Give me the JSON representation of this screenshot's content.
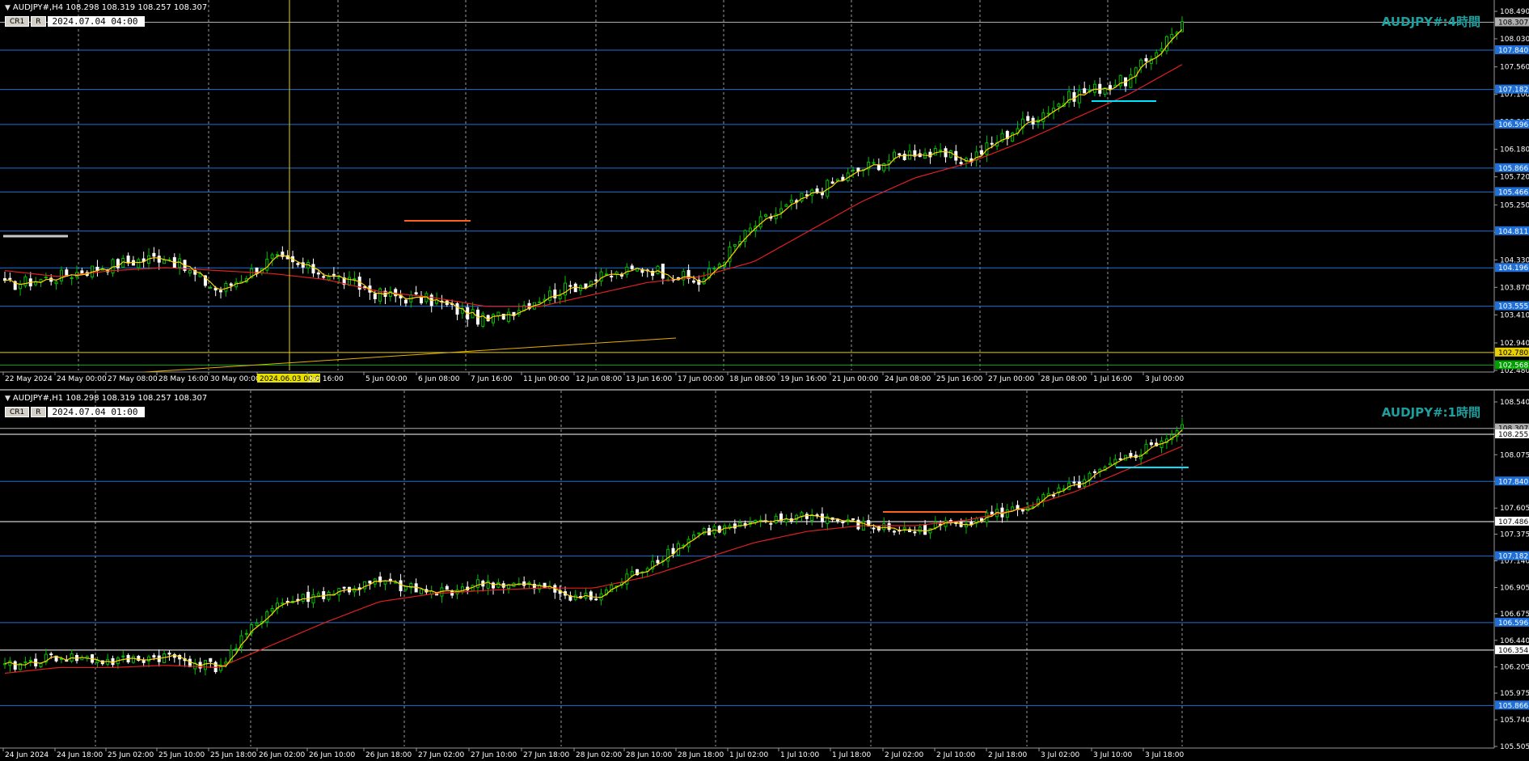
{
  "top": {
    "header": "AUDJPY#,H4  108.298 108.319 108.257 108.307",
    "ctrl_label": "CR1",
    "ctrl_r": "R",
    "timestamp": "2024.07.04 04:00",
    "title": "AUDJPY#:4時間",
    "price_ticks": [
      "108.490",
      "108.030",
      "107.560",
      "107.100",
      "106.640",
      "106.180",
      "105.720",
      "105.250",
      "104.790",
      "104.330",
      "103.870",
      "103.410",
      "102.940",
      "102.480"
    ],
    "level_labels": [
      {
        "text": "108.307",
        "color": "#b0b0b0"
      },
      {
        "text": "107.840",
        "color": "#1e6fd8"
      },
      {
        "text": "107.182",
        "color": "#1e6fd8"
      },
      {
        "text": "106.596",
        "color": "#1e6fd8"
      },
      {
        "text": "105.866",
        "color": "#1e6fd8"
      },
      {
        "text": "105.466",
        "color": "#1e6fd8"
      },
      {
        "text": "104.811",
        "color": "#1e6fd8"
      },
      {
        "text": "104.196",
        "color": "#1e6fd8"
      },
      {
        "text": "103.555",
        "color": "#1e6fd8"
      },
      {
        "text": "102.780",
        "color": "#e8d000"
      },
      {
        "text": "102.568",
        "color": "#00a000"
      }
    ],
    "x_labels": [
      "22 May 2024",
      "24 May 00:00",
      "27 May 08:00",
      "28 May 16:00",
      "30 May 00:00",
      "2024.06.03 00:00",
      "Jun 16:00",
      "5 Jun 00:00",
      "6 Jun 08:00",
      "7 Jun 16:00",
      "11 Jun 00:00",
      "12 Jun 08:00",
      "13 Jun 16:00",
      "17 Jun 00:00",
      "18 Jun 08:00",
      "19 Jun 16:00",
      "21 Jun 00:00",
      "24 Jun 08:00",
      "25 Jun 16:00",
      "27 Jun 00:00",
      "28 Jun 08:00",
      "1 Jul 16:00",
      "3 Jul 00:00"
    ]
  },
  "bottom": {
    "header": "AUDJPY#,H1  108.298 108.319 108.257 108.307",
    "ctrl_label": "CR1",
    "ctrl_r": "R",
    "timestamp": "2024.07.04 01:00",
    "title": "AUDJPY#:1時間",
    "price_ticks": [
      "108.540",
      "108.307",
      "108.075",
      "107.840",
      "107.605",
      "107.375",
      "107.140",
      "106.905",
      "106.675",
      "106.440",
      "106.205",
      "105.975",
      "105.740",
      "105.505"
    ],
    "level_labels": [
      {
        "text": "108.307",
        "color": "#b0b0b0"
      },
      {
        "text": "108.255",
        "color": "#ffffff"
      },
      {
        "text": "107.840",
        "color": "#1e6fd8"
      },
      {
        "text": "107.486",
        "color": "#ffffff"
      },
      {
        "text": "107.182",
        "color": "#1e6fd8"
      },
      {
        "text": "106.596",
        "color": "#1e6fd8"
      },
      {
        "text": "106.354",
        "color": "#ffffff"
      },
      {
        "text": "105.866",
        "color": "#1e6fd8"
      }
    ],
    "x_labels": [
      "24 Jun 2024",
      "24 Jun 18:00",
      "25 Jun 02:00",
      "25 Jun 10:00",
      "25 Jun 18:00",
      "26 Jun 02:00",
      "26 Jun 10:00",
      "26 Jun 18:00",
      "27 Jun 02:00",
      "27 Jun 10:00",
      "27 Jun 18:00",
      "28 Jun 02:00",
      "28 Jun 10:00",
      "28 Jun 18:00",
      "1 Jul 02:00",
      "1 Jul 10:00",
      "1 Jul 18:00",
      "2 Jul 02:00",
      "2 Jul 10:00",
      "2 Jul 18:00",
      "3 Jul 02:00",
      "3 Jul 10:00",
      "3 Jul 18:00"
    ]
  },
  "colors": {
    "up_candle": "#00c000",
    "down_candle": "#ffffff",
    "fast_ma": "#ffd000",
    "slow_ma": "#e02020",
    "blue_level": "#1e6fd8",
    "white_level": "#ffffff",
    "yellow_level": "#e8d000",
    "cyan_mark": "#00e5ff",
    "orange_mark": "#ff6020",
    "title": "#1e9f9f"
  },
  "chart_data": [
    {
      "type": "line",
      "title": "AUDJPY#:4時間",
      "ylim": [
        102.48,
        108.49
      ],
      "x": [
        "22 May 2024",
        "24 May 00:00",
        "27 May 08:00",
        "28 May 16:00",
        "30 May 00:00",
        "2024.06.03 00:00",
        "Jun 16:00",
        "5 Jun 00:00",
        "6 Jun 08:00",
        "7 Jun 16:00",
        "11 Jun 00:00",
        "12 Jun 08:00",
        "13 Jun 16:00",
        "17 Jun 00:00",
        "18 Jun 08:00",
        "19 Jun 16:00",
        "21 Jun 00:00",
        "24 Jun 08:00",
        "25 Jun 16:00",
        "27 Jun 00:00",
        "28 Jun 08:00",
        "1 Jul 16:00",
        "3 Jul 00:00"
      ],
      "series": [
        {
          "values": [
            103.9,
            104.05,
            104.25,
            104.4,
            103.8,
            104.35,
            104.1,
            103.75,
            103.65,
            103.3,
            103.7,
            104.0,
            104.2,
            103.95,
            104.9,
            105.4,
            105.85,
            106.15,
            106.0,
            106.6,
            107.1,
            107.35,
            108.3
          ]
        },
        {
          "values": [
            104.15,
            104.05,
            104.15,
            104.2,
            104.15,
            104.1,
            104.0,
            103.8,
            103.7,
            103.55,
            103.55,
            103.75,
            103.95,
            104.05,
            104.3,
            104.8,
            105.3,
            105.7,
            105.95,
            106.3,
            106.7,
            107.1,
            107.6
          ]
        }
      ]
    },
    {
      "type": "line",
      "title": "AUDJPY#:1時間",
      "ylim": [
        105.505,
        108.54
      ],
      "x": [
        "24 Jun 2024",
        "24 Jun 18:00",
        "25 Jun 02:00",
        "25 Jun 10:00",
        "25 Jun 18:00",
        "26 Jun 02:00",
        "26 Jun 10:00",
        "26 Jun 18:00",
        "27 Jun 02:00",
        "27 Jun 10:00",
        "27 Jun 18:00",
        "28 Jun 02:00",
        "28 Jun 10:00",
        "28 Jun 18:00",
        "1 Jul 02:00",
        "1 Jul 10:00",
        "1 Jul 18:00",
        "2 Jul 02:00",
        "2 Jul 10:00",
        "2 Jul 18:00",
        "3 Jul 02:00",
        "3 Jul 10:00",
        "3 Jul 18:00"
      ],
      "series": [
        {
          "values": [
            106.2,
            106.3,
            106.25,
            106.3,
            106.2,
            106.75,
            106.85,
            106.95,
            106.85,
            106.95,
            106.9,
            106.8,
            107.1,
            107.4,
            107.45,
            107.55,
            107.45,
            107.4,
            107.5,
            107.6,
            107.8,
            108.05,
            108.3
          ]
        },
        {
          "values": [
            106.15,
            106.2,
            106.2,
            106.22,
            106.2,
            106.4,
            106.6,
            106.78,
            106.85,
            106.88,
            106.9,
            106.9,
            107.0,
            107.15,
            107.3,
            107.4,
            107.45,
            107.45,
            107.5,
            107.6,
            107.75,
            107.95,
            108.15
          ]
        }
      ]
    }
  ]
}
